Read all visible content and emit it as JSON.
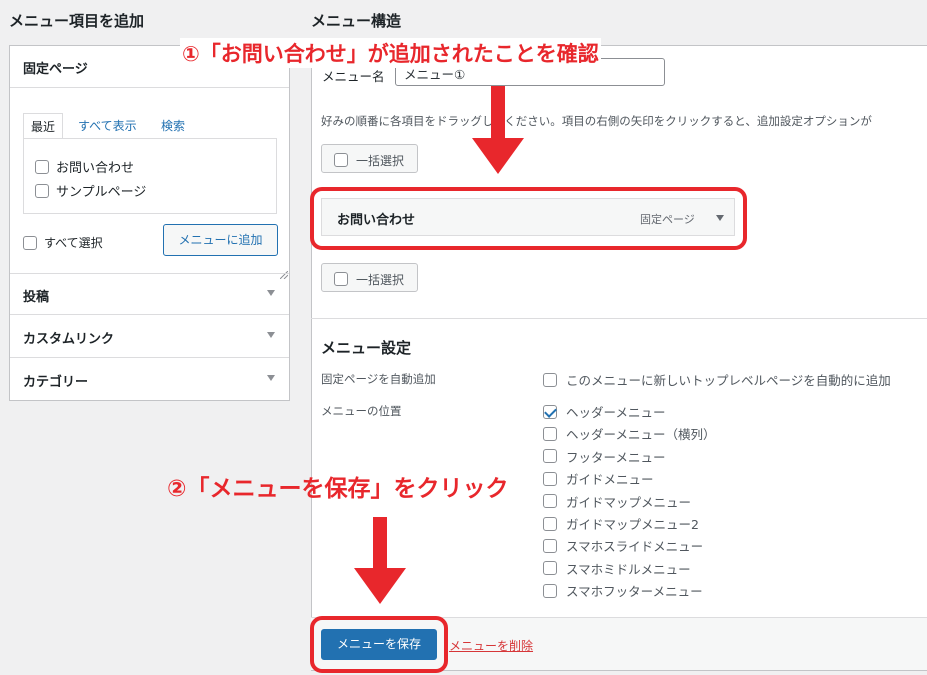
{
  "left": {
    "title": "メニュー項目を追加",
    "pages_section": {
      "title": "固定ページ",
      "tabs": [
        "最近",
        "すべて表示",
        "検索"
      ],
      "items": [
        "お問い合わせ",
        "サンプルページ"
      ],
      "select_all": "すべて選択",
      "add_button": "メニューに追加"
    },
    "sections": [
      "投稿",
      "カスタムリンク",
      "カテゴリー"
    ]
  },
  "right": {
    "title": "メニュー構造",
    "menu_name_label": "メニュー名",
    "menu_name_value": "メニュー①",
    "instructions": "好みの順番に各項目をドラッグしてください。項目の右側の矢印をクリックすると、追加設定オプションが",
    "bulk_select": "一括選択",
    "menu_item": {
      "title": "お問い合わせ",
      "type": "固定ページ"
    },
    "settings": {
      "title": "メニュー設定",
      "auto_add_label": "固定ページを自動追加",
      "auto_add_option": "このメニューに新しいトップレベルページを自動的に追加",
      "location_label": "メニューの位置",
      "locations": [
        {
          "label": "ヘッダーメニュー",
          "checked": true
        },
        {
          "label": "ヘッダーメニュー（横列）",
          "checked": false
        },
        {
          "label": "フッターメニュー",
          "checked": false
        },
        {
          "label": "ガイドメニュー",
          "checked": false
        },
        {
          "label": "ガイドマップメニュー",
          "checked": false
        },
        {
          "label": "ガイドマップメニュー2",
          "checked": false
        },
        {
          "label": "スマホスライドメニュー",
          "checked": false
        },
        {
          "label": "スマホミドルメニュー",
          "checked": false
        },
        {
          "label": "スマホフッターメニュー",
          "checked": false
        }
      ]
    },
    "save_button": "メニューを保存",
    "delete_link": "メニューを削除"
  },
  "annotations": {
    "step1": "①「お問い合わせ」が追加されたことを確認",
    "step2": "②「メニューを保存」をクリック",
    "color": "#e8272c"
  },
  "colors": {
    "primary": "#2271b1",
    "background": "#f0f0f1"
  }
}
